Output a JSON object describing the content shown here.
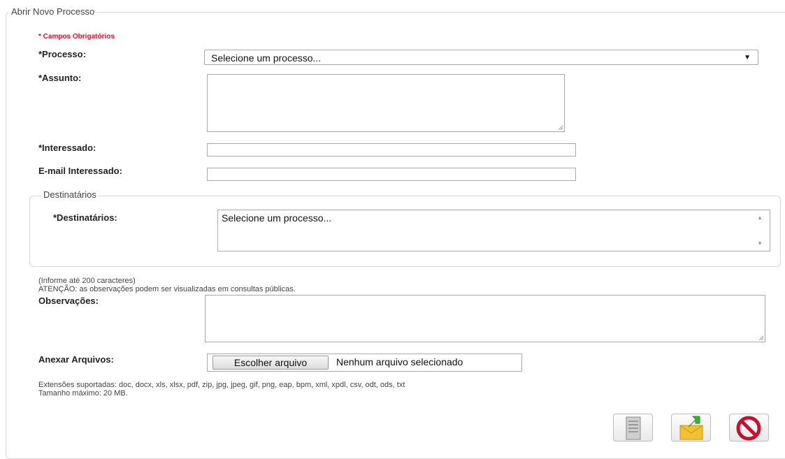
{
  "form": {
    "legend": "Abrir Novo Processo",
    "required_note": "* Campos Obrigatórios",
    "processo_label": "*Processo:",
    "processo_value": "Selecione um processo...",
    "assunto_label": "*Assunto:",
    "interessado_label": "*Interessado:",
    "email_label": "E-mail Interessado:"
  },
  "destinatarios": {
    "legend": "Destinatários",
    "label": "*Destinatários:",
    "value": "Selecione um processo..."
  },
  "observacoes": {
    "hint_chars": "(Informe até 200 caracteres)",
    "hint_warning": "ATENÇÃO: as observações podem ser visualizadas em consultas públicas.",
    "label": "Observações:"
  },
  "anexos": {
    "label": "Anexar Arquivos:",
    "button": "Escolher arquivo",
    "status": "Nenhum arquivo selecionado",
    "extensions": "Extensões suportadas: doc, docx, xls, xlsx, pdf, zip, jpg, jpeg, gif, png, eap, bpm, xml, xpdl, csv, odt, ods, txt",
    "max_size": "Tamanho máximo: 20 MB."
  },
  "actions": {
    "icons": [
      "document-icon",
      "send-icon",
      "cancel-icon"
    ]
  }
}
